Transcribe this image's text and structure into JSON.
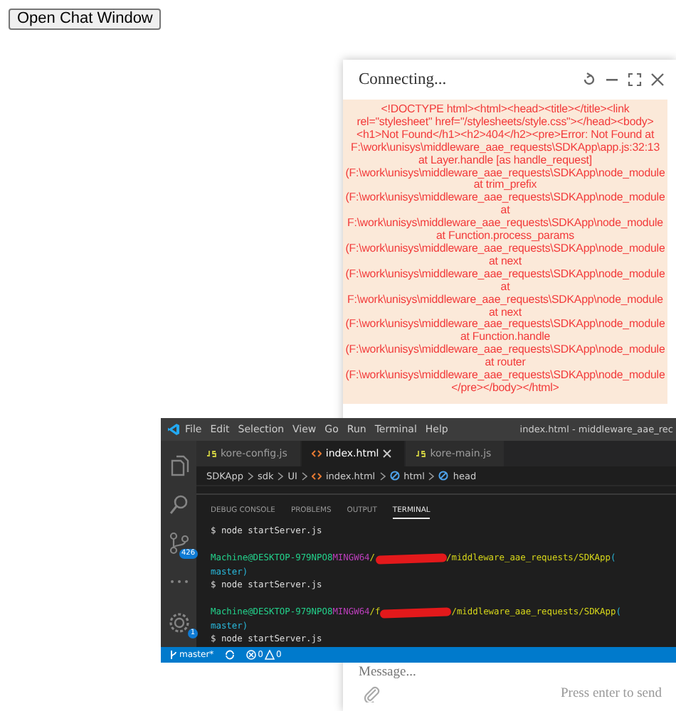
{
  "page_button": "Open Chat Window",
  "chat": {
    "title": "Connecting...",
    "error_lines": [
      "<!DOCTYPE html><html><head><title></title><link",
      "rel=\"stylesheet\" href=\"/stylesheets/style.css\"></head><body>",
      "<h1>Not Found</h1><h2>404</h2><pre>Error: Not Found at",
      "F:\\work\\unisys\\middleware_aae_requests\\SDKApp\\app.js:32:13",
      "at Layer.handle [as handle_request]",
      "(F:\\work\\unisys\\middleware_aae_requests\\SDKApp\\node_module",
      "at trim_prefix",
      "(F:\\work\\unisys\\middleware_aae_requests\\SDKApp\\node_module",
      "at",
      "F:\\work\\unisys\\middleware_aae_requests\\SDKApp\\node_module",
      "at Function.process_params",
      "(F:\\work\\unisys\\middleware_aae_requests\\SDKApp\\node_module",
      "at next",
      "(F:\\work\\unisys\\middleware_aae_requests\\SDKApp\\node_module",
      "at",
      "F:\\work\\unisys\\middleware_aae_requests\\SDKApp\\node_module",
      "at next",
      "(F:\\work\\unisys\\middleware_aae_requests\\SDKApp\\node_module",
      "at Function.handle",
      "(F:\\work\\unisys\\middleware_aae_requests\\SDKApp\\node_module",
      "at router",
      "(F:\\work\\unisys\\middleware_aae_requests\\SDKApp\\node_module",
      "</pre></body></html>"
    ],
    "message_placeholder": "Message...",
    "hint": "Press enter to send"
  },
  "editor": {
    "menu": [
      "File",
      "Edit",
      "Selection",
      "View",
      "Go",
      "Run",
      "Terminal",
      "Help"
    ],
    "title": "index.html - middleware_aae_rec",
    "activity": [
      {
        "kind": "files"
      },
      {
        "kind": "search"
      },
      {
        "kind": "source-control",
        "badge": "426"
      },
      {
        "kind": "more"
      },
      {
        "kind": "settings",
        "badge": "1"
      }
    ],
    "tabs": [
      {
        "label": "kore-config.js",
        "kind": "js",
        "selected": false
      },
      {
        "label": "index.html",
        "kind": "html",
        "selected": true
      },
      {
        "label": "kore-main.js",
        "kind": "js",
        "selected": false
      }
    ],
    "breadcrumb": [
      {
        "label": "SDKApp",
        "kind": "folder"
      },
      {
        "label": "sdk",
        "kind": "folder"
      },
      {
        "label": "UI",
        "kind": "folder"
      },
      {
        "label": "index.html",
        "kind": "file"
      },
      {
        "label": "html",
        "kind": "symbol"
      },
      {
        "label": "head",
        "kind": "symbol"
      }
    ],
    "panel_tabs": [
      {
        "label": "DEBUG CONSOLE",
        "selected": false
      },
      {
        "label": "PROBLEMS",
        "selected": false
      },
      {
        "label": "OUTPUT",
        "selected": false
      },
      {
        "label": "TERMINAL",
        "selected": true
      }
    ],
    "terminal": [
      {
        "kind": "command",
        "text": "$ node startServer.js"
      },
      {
        "kind": "prompt",
        "user": "Machine@DESKTOP-979NPO8",
        "shell": "MINGW64",
        "path_before": "/",
        "path_after": "/middleware_aae_requests/SDKApp",
        "paren": "("
      },
      {
        "kind": "branch",
        "text": "master)"
      },
      {
        "kind": "command",
        "text": "$ node startServer.js"
      },
      {
        "kind": "prompt",
        "user": "Machine@DESKTOP-979NPO8",
        "shell": "MINGW64",
        "path_before": "/f",
        "path_after": "/middleware_aae_requests/SDKApp",
        "paren": "("
      },
      {
        "kind": "branch",
        "text": "master)"
      },
      {
        "kind": "command",
        "text": "$ node startServer.js"
      }
    ],
    "status": {
      "branch": "master*",
      "errors": "0",
      "warnings": "0"
    }
  }
}
